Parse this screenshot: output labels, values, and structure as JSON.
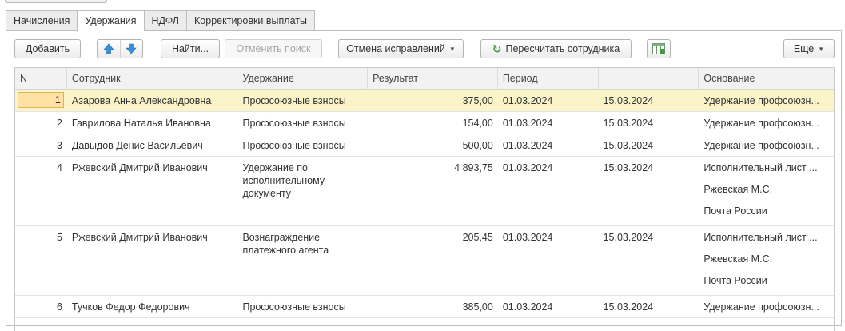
{
  "tabs": [
    {
      "label": "Начисления",
      "active": false
    },
    {
      "label": "Удержания",
      "active": true
    },
    {
      "label": "НДФЛ",
      "active": false
    },
    {
      "label": "Корректировки выплаты",
      "active": false
    }
  ],
  "toolbar": {
    "add_label": "Добавить",
    "find_label": "Найти...",
    "cancel_search_label": "Отменить поиск",
    "cancel_corrections_label": "Отмена исправлений",
    "recalc_label": "Пересчитать сотрудника",
    "more_label": "Еще"
  },
  "table": {
    "headers": {
      "n": "N",
      "employee": "Сотрудник",
      "deduction": "Удержание",
      "result": "Результат",
      "period": "Период",
      "period_end": "",
      "basis": "Основание"
    },
    "rows": [
      {
        "n": "1",
        "employee": "Азарова Анна Александровна",
        "deduction": "Профсоюзные взносы",
        "result": "375,00",
        "period_start": "01.03.2024",
        "period_end": "15.03.2024",
        "basis": [
          "Удержание профсоюзн..."
        ]
      },
      {
        "n": "2",
        "employee": "Гаврилова Наталья Ивановна",
        "deduction": "Профсоюзные взносы",
        "result": "154,00",
        "period_start": "01.03.2024",
        "period_end": "15.03.2024",
        "basis": [
          "Удержание профсоюзн..."
        ]
      },
      {
        "n": "3",
        "employee": "Давыдов Денис Васильевич",
        "deduction": "Профсоюзные взносы",
        "result": "500,00",
        "period_start": "01.03.2024",
        "period_end": "15.03.2024",
        "basis": [
          "Удержание профсоюзн..."
        ]
      },
      {
        "n": "4",
        "employee": "Ржевский Дмитрий Иванович",
        "deduction": "Удержание по исполнительному документу",
        "result": "4 893,75",
        "period_start": "01.03.2024",
        "period_end": "15.03.2024",
        "basis": [
          "Исполнительный лист ...",
          "Ржевская М.С.",
          "Почта России"
        ]
      },
      {
        "n": "5",
        "employee": "Ржевский Дмитрий Иванович",
        "deduction": "Вознаграждение платежного агента",
        "result": "205,45",
        "period_start": "01.03.2024",
        "period_end": "15.03.2024",
        "basis": [
          "Исполнительный лист ...",
          "Ржевская М.С.",
          "Почта России"
        ]
      },
      {
        "n": "6",
        "employee": "Тучков Федор Федорович",
        "deduction": "Профсоюзные взносы",
        "result": "385,00",
        "period_start": "01.03.2024",
        "period_end": "15.03.2024",
        "basis": [
          "Удержание профсоюзн..."
        ]
      }
    ]
  },
  "colors": {
    "selected_row": "#fcf4c9",
    "accent_blue": "#3b8fd9",
    "refresh_green": "#3d9e3d"
  }
}
